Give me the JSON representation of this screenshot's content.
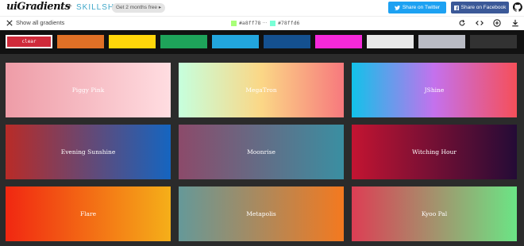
{
  "header": {
    "logo": "uiGradients",
    "plus": "+",
    "partner": "SKILLSHARE",
    "promo": "Get 2 months free ▸",
    "share_twitter": "Share on Twitter",
    "share_facebook": "Share on Facebook",
    "icons": [
      "twitter-icon",
      "facebook-icon",
      "github-icon"
    ]
  },
  "toolbar": {
    "show_all": "Show all gradients",
    "color_from": "#a8ff78",
    "color_to": "#78ffd6",
    "separator": "…",
    "icons": [
      "rotate-icon",
      "code-icon",
      "add-icon",
      "download-icon"
    ]
  },
  "filters": {
    "clear_label": "clear",
    "colors": [
      "#cf2a3a",
      "#e07026",
      "#ffd60a",
      "#1ea35a",
      "#22a5dd",
      "#14508f",
      "#f529da",
      "#e8e8e8",
      "#b9bbc4",
      "#323232"
    ]
  },
  "gradients": [
    {
      "name": "Piggy Pink",
      "from": "#ee9ca7",
      "to": "#ffdde1"
    },
    {
      "name": "MegaTron",
      "from": "#c6ffdd",
      "mid": "#fbd786",
      "to": "#f7797d"
    },
    {
      "name": "JShine",
      "from": "#12c2e9",
      "mid": "#c471ed",
      "to": "#f64f59"
    },
    {
      "name": "Evening Sunshine",
      "from": "#b92b27",
      "to": "#1565c0"
    },
    {
      "name": "Moonrise",
      "from": "#8c4a6a",
      "to": "#3a8fa2"
    },
    {
      "name": "Witching Hour",
      "from": "#c31432",
      "to": "#240b36"
    },
    {
      "name": "Flare",
      "from": "#f12711",
      "to": "#f5af19"
    },
    {
      "name": "Metapolis",
      "from": "#659999",
      "to": "#f4791f"
    },
    {
      "name": "Kyoo Pal",
      "from": "#dd3e54",
      "to": "#6be585"
    }
  ]
}
